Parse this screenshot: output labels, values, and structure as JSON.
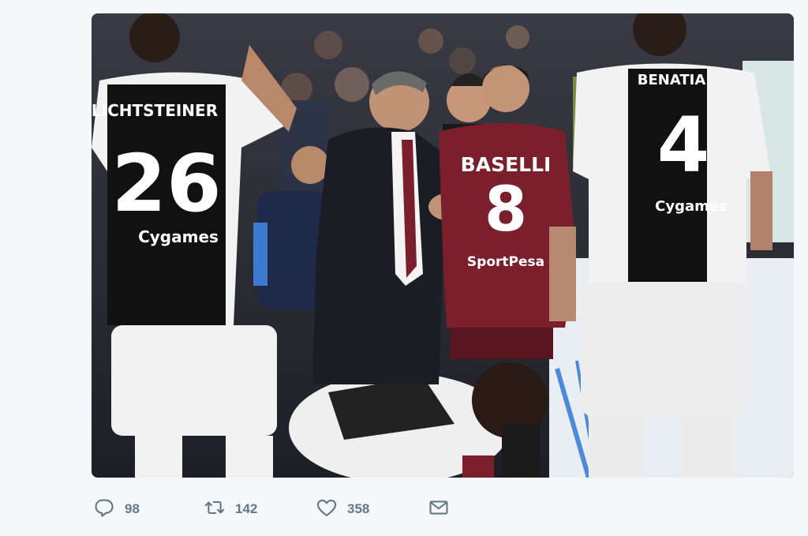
{
  "tweet": {
    "media": {
      "alt": "",
      "jerseys": {
        "left": {
          "name": "LICHTSTEINER",
          "number": "26",
          "sponsor": "Cygames"
        },
        "center": {
          "name": "BASELLI",
          "number": "8",
          "sponsor": "SportPesa"
        },
        "right": {
          "name": "BENATIA",
          "number": "4",
          "sponsor": "Cygames"
        }
      }
    },
    "actions": {
      "reply_count": "98",
      "retweet_count": "142",
      "like_count": "358"
    }
  },
  "icons": {
    "reply": "reply-icon",
    "retweet": "retweet-icon",
    "like": "heart-icon",
    "message": "envelope-icon"
  },
  "colors": {
    "action_gray": "#657786",
    "background": "#f5f8fa",
    "torino_maroon": "#7a1f2b"
  }
}
